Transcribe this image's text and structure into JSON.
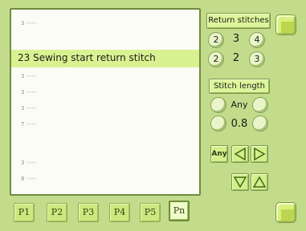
{
  "list": {
    "rows": [
      {
        "label": "3 ----",
        "selected": false
      },
      {
        "label": "",
        "selected": false
      },
      {
        "label": "23 Sewing start return stitch",
        "selected": true
      },
      {
        "label": "3 ----",
        "selected": false
      },
      {
        "label": "3 ----",
        "selected": false
      },
      {
        "label": "3 ----",
        "selected": false
      },
      {
        "label": "7 ----",
        "selected": false
      },
      {
        "label": "",
        "selected": false
      },
      {
        "label": "3 ----",
        "selected": false
      },
      {
        "label": "8 ----",
        "selected": false
      }
    ]
  },
  "return_stitches": {
    "title": "Return stitches",
    "row1": {
      "left": "2",
      "center": "3",
      "right": "4"
    },
    "row2": {
      "left": "2",
      "center": "2",
      "right": "3"
    }
  },
  "stitch_length": {
    "title": "Stitch length",
    "mode": "Any",
    "value": "0.8"
  },
  "controls": {
    "any_label": "Any",
    "left_icon": "triangle-left-icon",
    "right_icon": "triangle-right-icon",
    "down_icon": "triangle-down-icon",
    "up_icon": "triangle-up-icon"
  },
  "tabs": [
    {
      "label": "P1",
      "active": false
    },
    {
      "label": "P2",
      "active": false
    },
    {
      "label": "P3",
      "active": false
    },
    {
      "label": "P4",
      "active": false
    },
    {
      "label": "P5",
      "active": false
    },
    {
      "label": "Pn",
      "active": true
    }
  ],
  "colors": {
    "background": "#c2dc8c",
    "selected_row": "#d9f291",
    "button_face": "#dcf59b"
  }
}
